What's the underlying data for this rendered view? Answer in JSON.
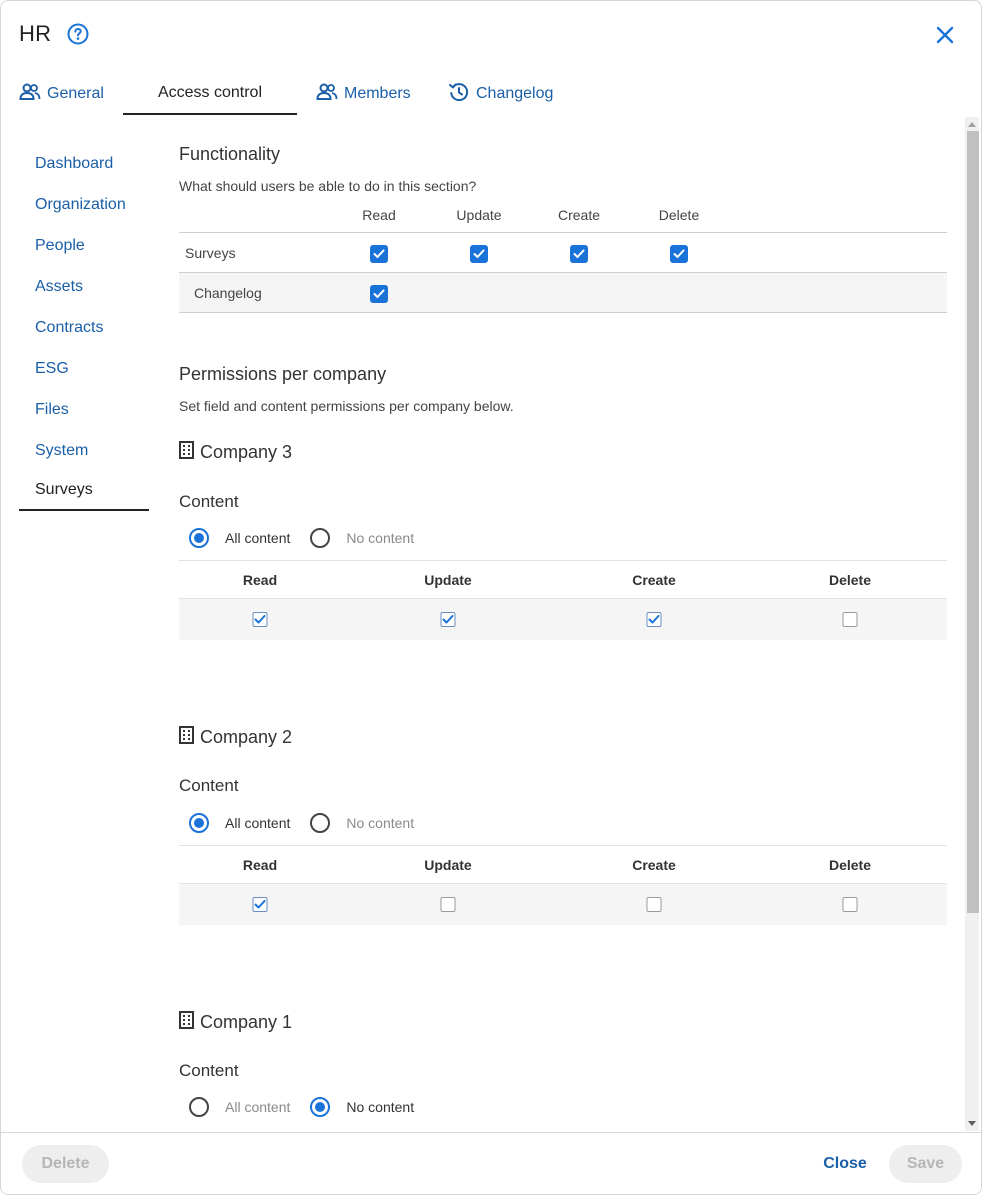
{
  "header": {
    "title": "HR"
  },
  "tabs": [
    {
      "label": "General",
      "icon": "users-icon"
    },
    {
      "label": "Access control"
    },
    {
      "label": "Members",
      "icon": "users-icon"
    },
    {
      "label": "Changelog",
      "icon": "history-icon"
    }
  ],
  "sidebar": {
    "items": [
      {
        "label": "Dashboard"
      },
      {
        "label": "Organization"
      },
      {
        "label": "People"
      },
      {
        "label": "Assets"
      },
      {
        "label": "Contracts"
      },
      {
        "label": "ESG"
      },
      {
        "label": "Files"
      },
      {
        "label": "System"
      },
      {
        "label": "Surveys",
        "active": true
      }
    ]
  },
  "functionality": {
    "title": "Functionality",
    "description": "What should users be able to do in this section?",
    "columns": [
      "Read",
      "Update",
      "Create",
      "Delete"
    ],
    "rows": [
      {
        "label": "Surveys",
        "read": true,
        "update": true,
        "create": true,
        "delete": true
      },
      {
        "label": "Changelog",
        "read": true
      }
    ]
  },
  "permissions": {
    "title": "Permissions per company",
    "description": "Set field and content permissions per company below.",
    "content_label": "Content",
    "all_content_label": "All content",
    "no_content_label": "No content",
    "columns": [
      "Read",
      "Update",
      "Create",
      "Delete"
    ],
    "companies": [
      {
        "name": "Company 3",
        "content": "all",
        "read": true,
        "update": true,
        "create": true,
        "delete": false
      },
      {
        "name": "Company 2",
        "content": "all",
        "read": true,
        "update": false,
        "create": false,
        "delete": false
      },
      {
        "name": "Company 1",
        "content": "none"
      }
    ]
  },
  "footer": {
    "delete_label": "Delete",
    "close_label": "Close",
    "save_label": "Save"
  },
  "colors": {
    "accent": "#1a73d9",
    "link": "#1a5fa8"
  }
}
